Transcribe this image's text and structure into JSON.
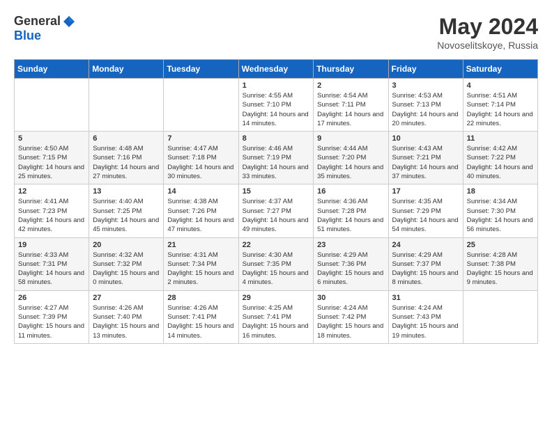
{
  "header": {
    "logo_general": "General",
    "logo_blue": "Blue",
    "month_year": "May 2024",
    "location": "Novoselitskoye, Russia"
  },
  "days_of_week": [
    "Sunday",
    "Monday",
    "Tuesday",
    "Wednesday",
    "Thursday",
    "Friday",
    "Saturday"
  ],
  "weeks": [
    {
      "days": [
        {
          "number": "",
          "info": ""
        },
        {
          "number": "",
          "info": ""
        },
        {
          "number": "",
          "info": ""
        },
        {
          "number": "1",
          "info": "Sunrise: 4:55 AM\nSunset: 7:10 PM\nDaylight: 14 hours and 14 minutes."
        },
        {
          "number": "2",
          "info": "Sunrise: 4:54 AM\nSunset: 7:11 PM\nDaylight: 14 hours and 17 minutes."
        },
        {
          "number": "3",
          "info": "Sunrise: 4:53 AM\nSunset: 7:13 PM\nDaylight: 14 hours and 20 minutes."
        },
        {
          "number": "4",
          "info": "Sunrise: 4:51 AM\nSunset: 7:14 PM\nDaylight: 14 hours and 22 minutes."
        }
      ]
    },
    {
      "days": [
        {
          "number": "5",
          "info": "Sunrise: 4:50 AM\nSunset: 7:15 PM\nDaylight: 14 hours and 25 minutes."
        },
        {
          "number": "6",
          "info": "Sunrise: 4:48 AM\nSunset: 7:16 PM\nDaylight: 14 hours and 27 minutes."
        },
        {
          "number": "7",
          "info": "Sunrise: 4:47 AM\nSunset: 7:18 PM\nDaylight: 14 hours and 30 minutes."
        },
        {
          "number": "8",
          "info": "Sunrise: 4:46 AM\nSunset: 7:19 PM\nDaylight: 14 hours and 33 minutes."
        },
        {
          "number": "9",
          "info": "Sunrise: 4:44 AM\nSunset: 7:20 PM\nDaylight: 14 hours and 35 minutes."
        },
        {
          "number": "10",
          "info": "Sunrise: 4:43 AM\nSunset: 7:21 PM\nDaylight: 14 hours and 37 minutes."
        },
        {
          "number": "11",
          "info": "Sunrise: 4:42 AM\nSunset: 7:22 PM\nDaylight: 14 hours and 40 minutes."
        }
      ]
    },
    {
      "days": [
        {
          "number": "12",
          "info": "Sunrise: 4:41 AM\nSunset: 7:23 PM\nDaylight: 14 hours and 42 minutes."
        },
        {
          "number": "13",
          "info": "Sunrise: 4:40 AM\nSunset: 7:25 PM\nDaylight: 14 hours and 45 minutes."
        },
        {
          "number": "14",
          "info": "Sunrise: 4:38 AM\nSunset: 7:26 PM\nDaylight: 14 hours and 47 minutes."
        },
        {
          "number": "15",
          "info": "Sunrise: 4:37 AM\nSunset: 7:27 PM\nDaylight: 14 hours and 49 minutes."
        },
        {
          "number": "16",
          "info": "Sunrise: 4:36 AM\nSunset: 7:28 PM\nDaylight: 14 hours and 51 minutes."
        },
        {
          "number": "17",
          "info": "Sunrise: 4:35 AM\nSunset: 7:29 PM\nDaylight: 14 hours and 54 minutes."
        },
        {
          "number": "18",
          "info": "Sunrise: 4:34 AM\nSunset: 7:30 PM\nDaylight: 14 hours and 56 minutes."
        }
      ]
    },
    {
      "days": [
        {
          "number": "19",
          "info": "Sunrise: 4:33 AM\nSunset: 7:31 PM\nDaylight: 14 hours and 58 minutes."
        },
        {
          "number": "20",
          "info": "Sunrise: 4:32 AM\nSunset: 7:32 PM\nDaylight: 15 hours and 0 minutes."
        },
        {
          "number": "21",
          "info": "Sunrise: 4:31 AM\nSunset: 7:34 PM\nDaylight: 15 hours and 2 minutes."
        },
        {
          "number": "22",
          "info": "Sunrise: 4:30 AM\nSunset: 7:35 PM\nDaylight: 15 hours and 4 minutes."
        },
        {
          "number": "23",
          "info": "Sunrise: 4:29 AM\nSunset: 7:36 PM\nDaylight: 15 hours and 6 minutes."
        },
        {
          "number": "24",
          "info": "Sunrise: 4:29 AM\nSunset: 7:37 PM\nDaylight: 15 hours and 8 minutes."
        },
        {
          "number": "25",
          "info": "Sunrise: 4:28 AM\nSunset: 7:38 PM\nDaylight: 15 hours and 9 minutes."
        }
      ]
    },
    {
      "days": [
        {
          "number": "26",
          "info": "Sunrise: 4:27 AM\nSunset: 7:39 PM\nDaylight: 15 hours and 11 minutes."
        },
        {
          "number": "27",
          "info": "Sunrise: 4:26 AM\nSunset: 7:40 PM\nDaylight: 15 hours and 13 minutes."
        },
        {
          "number": "28",
          "info": "Sunrise: 4:26 AM\nSunset: 7:41 PM\nDaylight: 15 hours and 14 minutes."
        },
        {
          "number": "29",
          "info": "Sunrise: 4:25 AM\nSunset: 7:41 PM\nDaylight: 15 hours and 16 minutes."
        },
        {
          "number": "30",
          "info": "Sunrise: 4:24 AM\nSunset: 7:42 PM\nDaylight: 15 hours and 18 minutes."
        },
        {
          "number": "31",
          "info": "Sunrise: 4:24 AM\nSunset: 7:43 PM\nDaylight: 15 hours and 19 minutes."
        },
        {
          "number": "",
          "info": ""
        }
      ]
    }
  ]
}
